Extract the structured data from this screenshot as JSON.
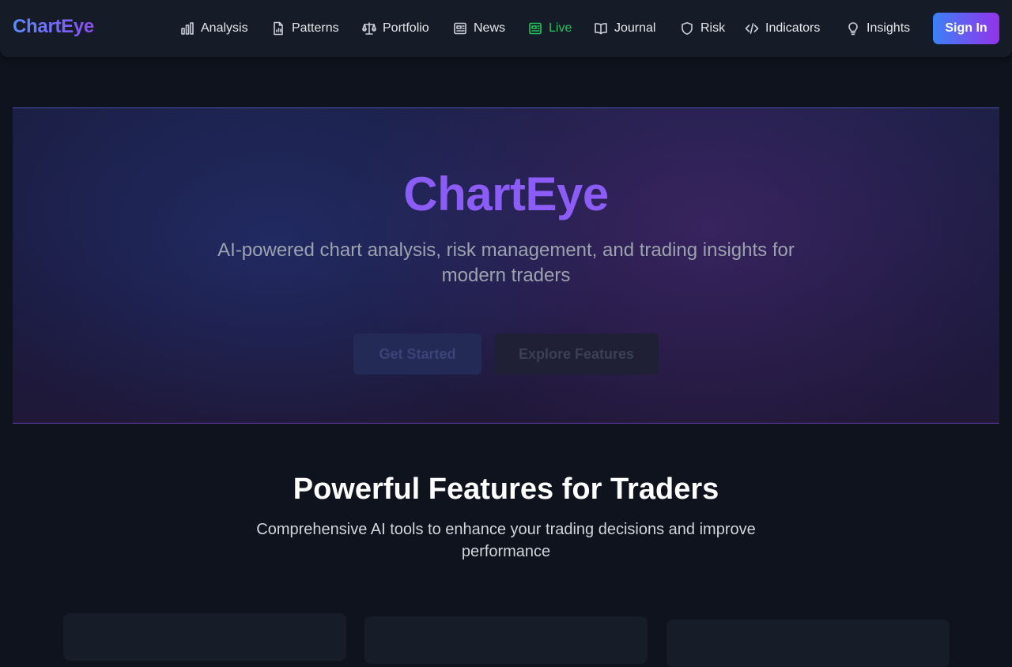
{
  "brand": {
    "name": "ChartEye"
  },
  "nav": {
    "items": [
      {
        "label": "Analysis",
        "icon": "bar-chart-icon"
      },
      {
        "label": "Patterns",
        "icon": "file-chart-icon"
      },
      {
        "label": "Portfolio",
        "icon": "scale-icon"
      },
      {
        "label": "News",
        "icon": "newspaper-icon"
      },
      {
        "label": "Live",
        "icon": "live-newspaper-icon"
      },
      {
        "label": "Journal",
        "icon": "book-icon"
      },
      {
        "label": "Risk",
        "icon": "shield-icon"
      },
      {
        "label": "Indicators",
        "icon": "code-icon"
      },
      {
        "label": "Insights",
        "icon": "lightbulb-icon"
      }
    ],
    "signin_label": "Sign In"
  },
  "hero": {
    "title": "ChartEye",
    "subtitle": "AI-powered chart analysis, risk management, and trading insights for modern traders",
    "primary_button": "Get Started",
    "secondary_button": "Explore Features"
  },
  "features": {
    "title": "Powerful Features for Traders",
    "subtitle": "Comprehensive AI tools to enhance your trading decisions and improve performance"
  },
  "colors": {
    "background": "#0e131d",
    "accent_blue": "#3b82f6",
    "accent_purple": "#8b5cf6",
    "live_green": "#22c55e"
  }
}
